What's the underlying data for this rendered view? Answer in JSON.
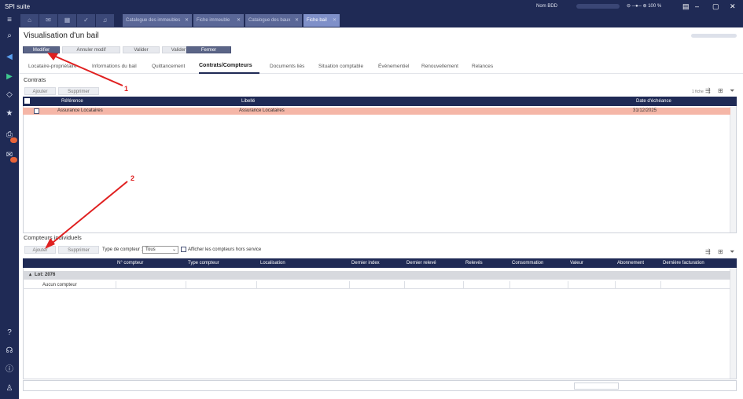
{
  "window": {
    "app_title": "SPI suite",
    "db_label": "Nom BDD",
    "zoom": "100 %"
  },
  "tabs": [
    {
      "label": "Catalogue des immeubles"
    },
    {
      "label": "Fiche immeuble"
    },
    {
      "label": "Catalogue des baux"
    },
    {
      "label": "Fiche bail"
    }
  ],
  "page": {
    "title": "Visualisation d'un bail"
  },
  "toolbar": {
    "modifier": "Modifier",
    "annuler": "Annuler modif",
    "valider": "Valider",
    "valider_plus": "Valider +",
    "fermer": "Fermer"
  },
  "navtabs": [
    "Locataire-propriétaire",
    "Informations du bail",
    "Quittancement",
    "Contrats/Compteurs",
    "Documents liés",
    "Situation comptable",
    "Événementiel",
    "Renouvellement",
    "Relances"
  ],
  "contrats": {
    "title": "Contrats",
    "add": "Ajouter",
    "delete": "Supprimer",
    "count": "1 fiche",
    "columns": [
      "Référence",
      "Libellé",
      "Date d'échéance"
    ],
    "rows": [
      {
        "reference": "Assurance Locataires",
        "libelle": "Assurance Locataires",
        "echeance": "31/12/2025"
      }
    ]
  },
  "compteurs": {
    "title": "Compteurs individuels",
    "add": "Ajouter",
    "delete": "Supprimer",
    "type_label": "Type de compteur :",
    "type_value": "Tous",
    "hors_service": "Afficher les compteurs hors service",
    "columns": [
      "N° compteur",
      "Type compteur",
      "Localisation",
      "Dernier index",
      "Dernier relevé",
      "Relevés",
      "Consommation",
      "Valeur",
      "Abonnement",
      "Dernière facturation"
    ],
    "group": "Lot: 2076",
    "empty": "Aucun compteur"
  },
  "annotations": {
    "first": "1",
    "second": "2"
  },
  "colors": {
    "navy": "#1f2a55",
    "highlight_row": "#f5b6a7",
    "annotation": "#e02020"
  }
}
